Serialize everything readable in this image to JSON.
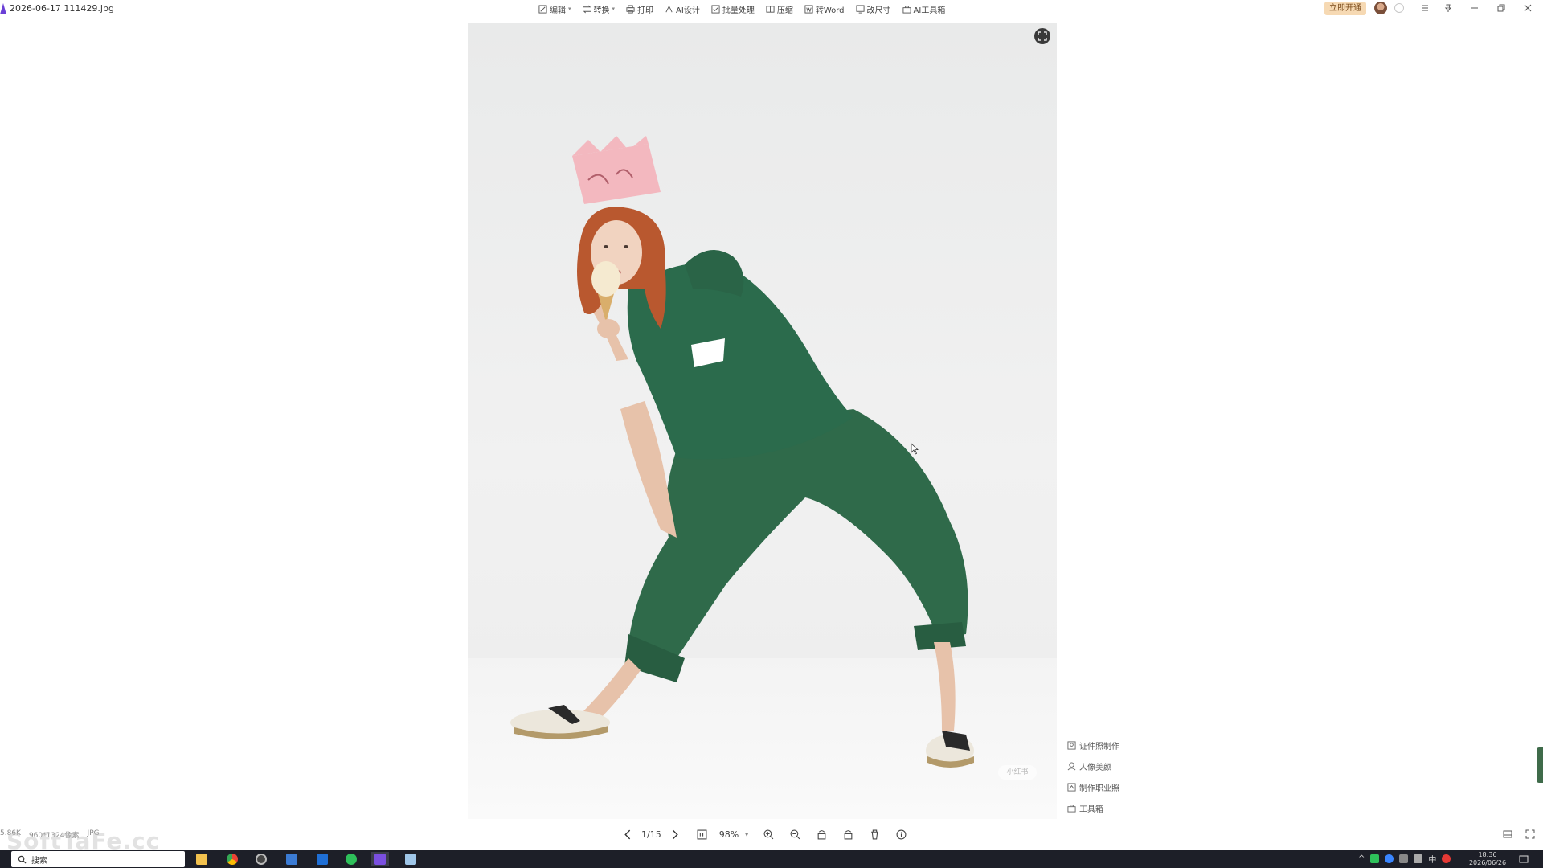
{
  "window": {
    "title": "2026-06-17 111429.jpg",
    "logo_icon": "app-logo-icon"
  },
  "toolbar": {
    "items": [
      {
        "label": "编辑",
        "icon": "edit-icon",
        "dropdown": true
      },
      {
        "label": "转换",
        "icon": "convert-icon",
        "dropdown": true
      },
      {
        "label": "打印",
        "icon": "print-icon",
        "dropdown": false
      },
      {
        "label": "AI设计",
        "icon": "ai-design-icon",
        "dropdown": false
      },
      {
        "label": "批量处理",
        "icon": "batch-icon",
        "dropdown": false
      },
      {
        "label": "压缩",
        "icon": "compress-icon",
        "dropdown": false
      },
      {
        "label": "转Word",
        "icon": "word-icon",
        "dropdown": false
      },
      {
        "label": "改尺寸",
        "icon": "resize-icon",
        "dropdown": false
      },
      {
        "label": "AI工具箱",
        "icon": "ai-toolbox-icon",
        "dropdown": false
      }
    ],
    "vip_label": "立即开通"
  },
  "window_controls": [
    "menu-icon",
    "pin-icon",
    "minimize-icon",
    "restore-icon",
    "close-icon"
  ],
  "photo": {
    "watermark": "小红书"
  },
  "quick_menu": {
    "items": [
      {
        "label": "证件照制作",
        "icon": "id-photo-icon"
      },
      {
        "label": "人像美颜",
        "icon": "portrait-icon"
      },
      {
        "label": "制作职业照",
        "icon": "professional-photo-icon"
      },
      {
        "label": "工具箱",
        "icon": "toolbox-icon"
      }
    ]
  },
  "status": {
    "file_size": "5.86K",
    "dimensions": "960*1324像素",
    "format": "JPG",
    "watermark_logo": "SoftTaFe.cc"
  },
  "nav": {
    "page": "1/15",
    "zoom": "98%"
  },
  "taskbar": {
    "search_label": "搜索",
    "ime": "中",
    "time": "18:36",
    "date": "2026/06/26"
  },
  "colors": {
    "vip_bg": "#f6d9b3",
    "taskbar_bg": "#1d1f28",
    "outfit_green": "#2b6b4c"
  }
}
